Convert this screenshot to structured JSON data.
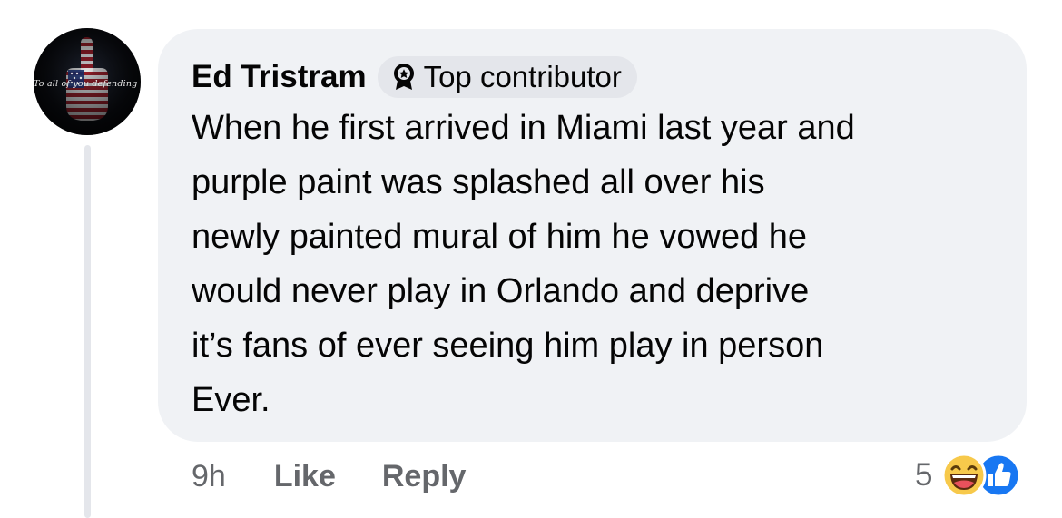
{
  "avatar": {
    "caption": "To all of you defending Trump",
    "icon": "middle-finger-flag-icon"
  },
  "comment": {
    "author": "Ed Tristram",
    "badge": {
      "icon": "top-contributor-icon",
      "label": "Top contributor"
    },
    "text": "When he first arrived in Miami last year and\npurple paint was splashed all over his\nnewly painted mural of him he vowed he\nwould never play in Orlando and deprive\nit’s fans of ever seeing him play in person\nEver."
  },
  "actions": {
    "timestamp": "9h",
    "like_label": "Like",
    "reply_label": "Reply"
  },
  "reactions": {
    "count": "5",
    "icons": [
      "haha-emoji-icon",
      "like-thumb-icon"
    ]
  },
  "colors": {
    "bubble_bg": "#f0f2f5",
    "badge_bg": "#e4e6eb",
    "text": "#050505",
    "secondary_text": "#65676b",
    "like_blue": "#1877f2",
    "haha_yellow": "#f7c94b"
  }
}
